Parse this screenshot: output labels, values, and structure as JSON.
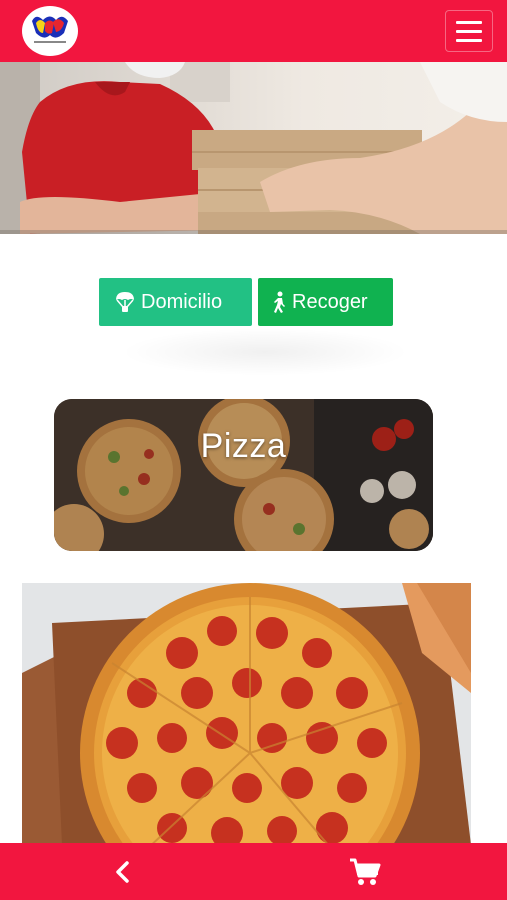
{
  "header": {
    "logo_icon": "brand-logo",
    "menu_icon": "hamburger-menu-icon",
    "color": "#f2163f"
  },
  "hero": {
    "image": "delivery-person-handing-pizza-boxes"
  },
  "delivery_options": {
    "domicilio": {
      "label": "Domicilio",
      "icon": "parachute-icon",
      "color": "#22c184"
    },
    "recoger": {
      "label": "Recoger",
      "icon": "walking-person-icon",
      "color": "#10b250"
    }
  },
  "category": {
    "title": "Pizza"
  },
  "product": {
    "image": "pepperoni-pizza-on-wooden-board"
  },
  "bottom_bar": {
    "back_icon": "chevron-left-icon",
    "cart_icon": "shopping-cart-icon",
    "color": "#f2163f"
  }
}
